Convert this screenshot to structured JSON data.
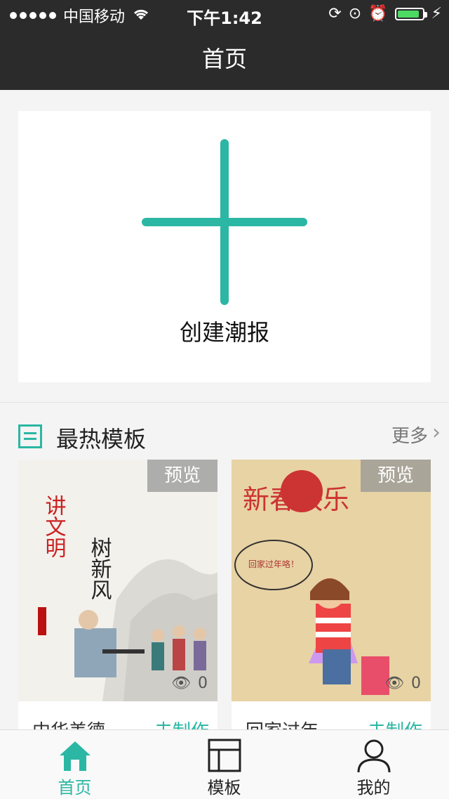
{
  "status_bar": {
    "carrier": "中国移动",
    "time": "下午1:42",
    "battery_level": 0.9
  },
  "navbar": {
    "title": "首页"
  },
  "create_card": {
    "label": "创建潮报"
  },
  "section": {
    "title": "最热模板",
    "more": "更多"
  },
  "templates": [
    {
      "preview": "预览",
      "views": "0",
      "title": "中华美德",
      "action": "去制作",
      "art_text": [
        "讲文明",
        "树新风"
      ]
    },
    {
      "preview": "预览",
      "views": "0",
      "title": "回家过年",
      "action": "去制作",
      "art_text": [
        "新春快乐",
        "回家过年咯！"
      ]
    }
  ],
  "tabbar": {
    "home": "首页",
    "template": "模板",
    "mine": "我的"
  },
  "colors": {
    "accent": "#2bb7a3",
    "topbar": "#2b2b2b"
  }
}
